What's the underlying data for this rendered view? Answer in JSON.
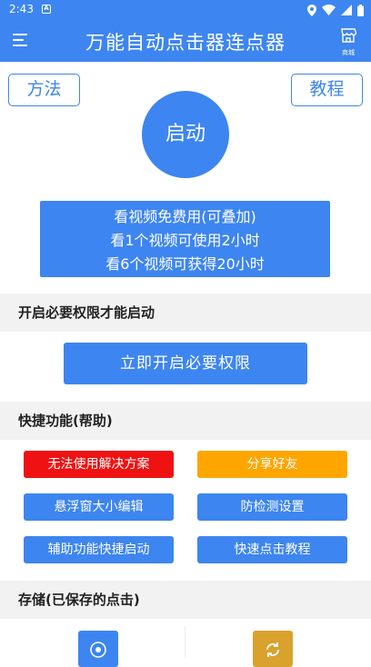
{
  "status_bar": {
    "time": "2:43",
    "notification_icon": "A"
  },
  "app_bar": {
    "title": "万能自动点击器连点器",
    "store_label": "商城"
  },
  "top_buttons": {
    "method": "方法",
    "tutorial": "教程"
  },
  "start_button": "启动",
  "promo": {
    "line1": "看视频免费用(可叠加)",
    "line2": "看1个视频可使用2小时",
    "line3": "看6个视频可获得20小时"
  },
  "permissions": {
    "header": "开启必要权限才能启动",
    "button": "立即开启必要权限"
  },
  "quick": {
    "header": "快捷功能(帮助)",
    "buttons": [
      {
        "label": "无法使用解决方案",
        "color": "#f01212"
      },
      {
        "label": "分享好友",
        "color": "#ffa500"
      },
      {
        "label": "悬浮窗大小编辑",
        "color": "#3d85f0"
      },
      {
        "label": "防检测设置",
        "color": "#3d85f0"
      },
      {
        "label": "辅助功能快捷启动",
        "color": "#3d85f0"
      },
      {
        "label": "快速点击教程",
        "color": "#3d85f0"
      }
    ]
  },
  "storage": {
    "header": "存储(已保存的点击)"
  },
  "colors": {
    "primary": "#3d85f0",
    "red": "#f01212",
    "orange": "#ffa500",
    "gold": "#d9a22c"
  },
  "icons": [
    "wifi-icon",
    "signal-icon",
    "battery-icon",
    "location-icon",
    "menu-icon",
    "store-icon",
    "target-icon",
    "refresh-icon"
  ]
}
